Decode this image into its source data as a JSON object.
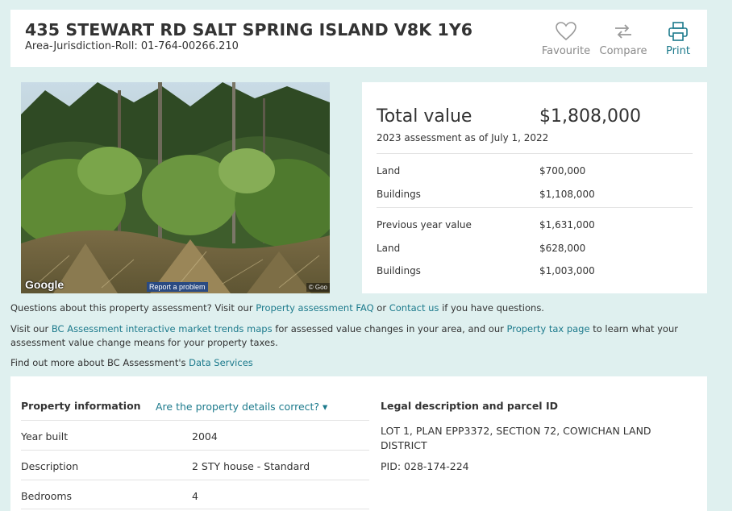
{
  "header": {
    "address": "435 STEWART RD SALT SPRING ISLAND V8K 1Y6",
    "roll_label": "Area-Jurisdiction-Roll: 01-764-00266.210",
    "actions": {
      "favourite": "Favourite",
      "compare": "Compare",
      "print": "Print"
    }
  },
  "street_view": {
    "google_label": "Google",
    "report_problem": "Report a problem",
    "copyright": "© Goo"
  },
  "valuation": {
    "total_label": "Total value",
    "total_value": "$1,808,000",
    "assessment_date": "2023 assessment as of July 1, 2022",
    "current": [
      {
        "label": "Land",
        "value": "$700,000"
      },
      {
        "label": "Buildings",
        "value": "$1,108,000"
      }
    ],
    "previous": [
      {
        "label": "Previous year value",
        "value": "$1,631,000"
      },
      {
        "label": "Land",
        "value": "$628,000"
      },
      {
        "label": "Buildings",
        "value": "$1,003,000"
      }
    ]
  },
  "info": {
    "questions_pre": "Questions about this property assessment? Visit our ",
    "faq_link": "Property assessment FAQ",
    "questions_or": " or ",
    "contact_link": "Contact us",
    "questions_post": " if you have questions.",
    "visit_pre": "Visit our ",
    "trends_link": "BC Assessment interactive market trends maps",
    "visit_mid": " for assessed value changes in your area, and our ",
    "tax_link": "Property tax page",
    "visit_post": " to learn what your assessment value change means for your property taxes.",
    "data_pre": "Find out more about BC Assessment's ",
    "data_link": "Data Services"
  },
  "property": {
    "title": "Property information",
    "correct_link": "Are the property details correct? ▾",
    "rows": [
      {
        "label": "Year built",
        "value": "2004"
      },
      {
        "label": "Description",
        "value": "2 STY house - Standard"
      },
      {
        "label": "Bedrooms",
        "value": "4"
      }
    ]
  },
  "legal": {
    "title": "Legal description and parcel ID",
    "description": "LOT 1, PLAN EPP3372, SECTION 72, COWICHAN LAND DISTRICT",
    "pid": "PID: 028-174-224"
  },
  "colors": {
    "background": "#dff0ef",
    "link": "#1c7a8c",
    "muted": "#8a8a8a"
  }
}
